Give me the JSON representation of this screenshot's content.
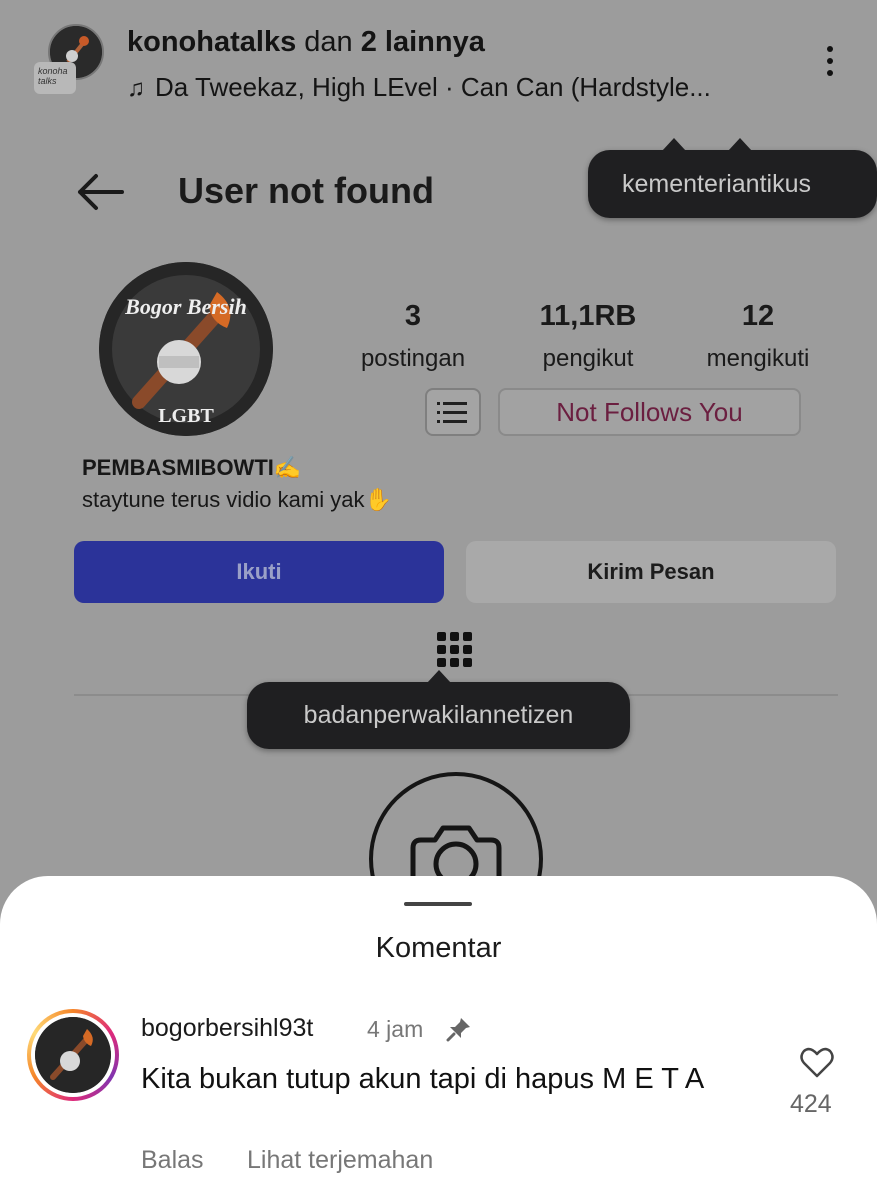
{
  "post_header": {
    "title_account": "konohatalks",
    "title_middle": " dan ",
    "title_others": "2 lainnya",
    "music_icon": "music-note-icon",
    "music": "Da Tweekaz, High LEvel · Can Can (Hardstyle...",
    "avatar_sub_text": "konoha talks"
  },
  "profile": {
    "page_title": "User not found",
    "avatar_text_top": "Bogor Bersih",
    "avatar_text_bottom": "LGBT",
    "stats": [
      {
        "value": "3",
        "label": "postingan"
      },
      {
        "value": "11,1RB",
        "label": "pengikut"
      },
      {
        "value": "12",
        "label": "mengikuti"
      }
    ],
    "follow_status": "Not Follows You",
    "display_name": "PEMBASMIBOWTI✍️",
    "bio": "staytune terus vidio kami yak✋",
    "follow_button": "Ikuti",
    "message_button": "Kirim Pesan"
  },
  "tags": {
    "tag1": "kementeriantikus",
    "tag2": "badanperwakilannetizen"
  },
  "comments_sheet": {
    "title": "Komentar",
    "comment": {
      "username": "bogorbersihl93t",
      "time": "4 jam",
      "text": "Kita bukan tutup akun tapi di hapus M E T A",
      "likes": "424",
      "reply": "Balas",
      "translate": "Lihat terjemahan"
    }
  },
  "colors": {
    "overlay_bg": "#9c9c9c",
    "follow_button": "#2b3399",
    "tooltip_bg": "#1f1f21",
    "sheet_bg": "#ffffff"
  }
}
